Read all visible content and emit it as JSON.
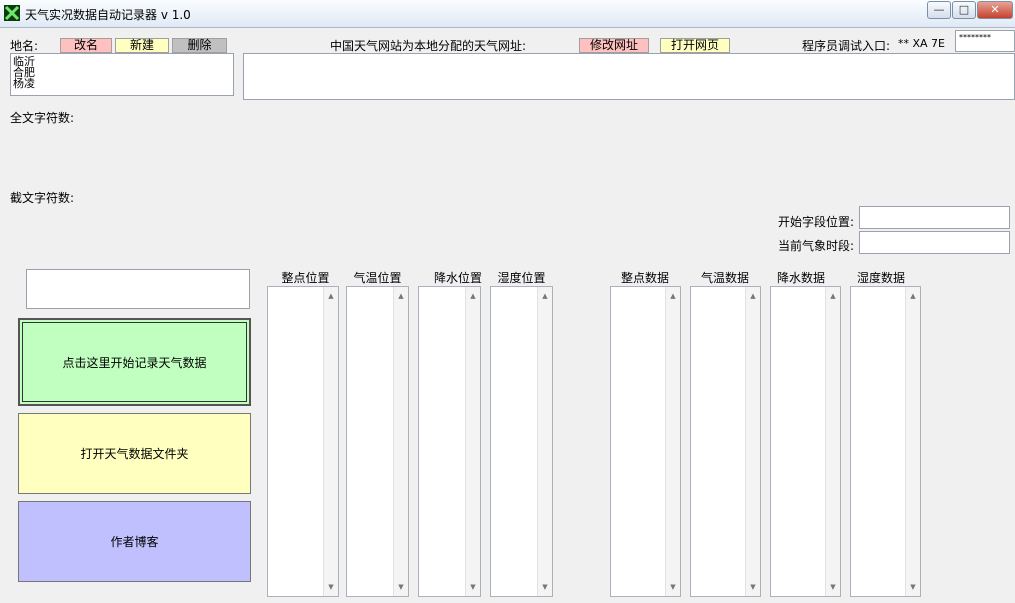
{
  "window": {
    "title": "天气实况数据自动记录器 v 1.0",
    "icon": "x-app-icon",
    "controls": {
      "minimize": "—",
      "maximize": "□",
      "close": "✕"
    }
  },
  "top": {
    "place_label": "地名:",
    "rename_label": "改名",
    "new_label": "新建",
    "delete_label": "删除",
    "url_label": "中国天气网站为本地分配的天气网址:",
    "modify_url_label": "修改网址",
    "open_page_label": "打开网页",
    "debug_label": "程序员调试入口:",
    "debug_code": "** XA 7E",
    "debug_password": "********",
    "places": [
      "临沂",
      "合肥",
      "杨凌"
    ],
    "url_value": ""
  },
  "info": {
    "full_count_label": "全文字符数:",
    "cut_count_label": "截文字符数:",
    "start_pos_label": "开始字段位置:",
    "current_period_label": "当前气象时段:"
  },
  "actions": {
    "start_record": "点击这里开始记录天气数据",
    "open_folder": "打开天气数据文件夹",
    "author_blog": "作者博客"
  },
  "columns": {
    "positions": [
      "整点位置",
      "气温位置",
      "降水位置",
      "湿度位置"
    ],
    "data": [
      "整点数据",
      "气温数据",
      "降水数据",
      "湿度数据"
    ]
  },
  "colors": {
    "rename_bg": "#ffc0c0",
    "new_bg": "#ffffc0",
    "delete_bg": "#c0c0c0",
    "modify_url_bg": "#ffc0c0",
    "open_page_bg": "#ffffc0",
    "start_btn_bg": "#c0ffc0",
    "folder_btn_bg": "#ffffc0",
    "blog_btn_bg": "#c0c0ff"
  }
}
